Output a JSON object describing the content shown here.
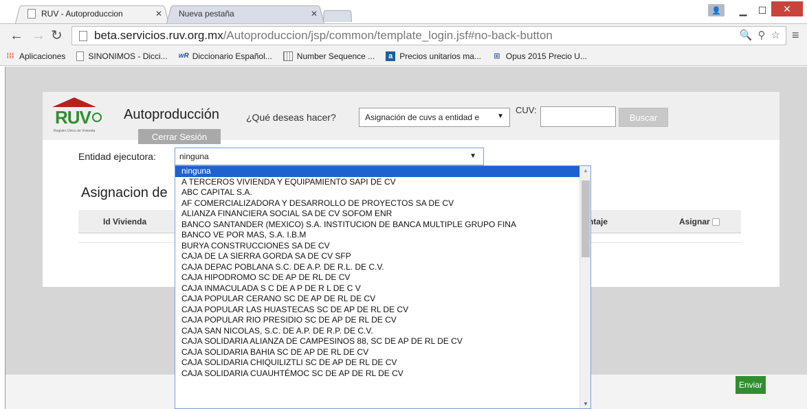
{
  "browser": {
    "tabs": [
      {
        "title": "RUV - Autoproduccion",
        "active": true
      },
      {
        "title": "Nueva pestaña",
        "active": false
      }
    ],
    "url_host": "beta.servicios.ruv.org.mx",
    "url_path": "/Autoproduccion/jsp/common/template_login.jsf#no-back-button",
    "bookmarks": [
      {
        "label": "Aplicaciones",
        "icon": "apps-icon"
      },
      {
        "label": "SINONIMOS - Dicci...",
        "icon": "page-icon"
      },
      {
        "label": "Diccionario Español...",
        "icon": "wordreference-icon"
      },
      {
        "label": "Number Sequence ...",
        "icon": "grid-icon"
      },
      {
        "label": "Precios unitarios ma...",
        "icon": "a-icon"
      },
      {
        "label": "Opus 2015 Precio U...",
        "icon": "network-icon"
      }
    ]
  },
  "header": {
    "logo_text": "RUV",
    "logo_tagline": "Registro Único de Vivienda",
    "app_title": "Autoproducción",
    "question": "¿Qué deseas hacer?",
    "action_value": "Asignación de cuvs a entidad e",
    "cuv_label": "CUV:",
    "search_label": "Buscar",
    "logout_label": "Cerrar Sesión"
  },
  "form": {
    "entity_label": "Entidad ejecutora:",
    "entity_value": "ninguna",
    "section_title": "Asignacion de",
    "columns": {
      "id": "Id Vivienda",
      "pct": "ntaje",
      "assign": "Asignar"
    },
    "send_label": "Enviar"
  },
  "dropdown_options": [
    "ninguna",
    "A TERCEROS VIVIENDA Y EQUIPAMIENTO SAPI DE CV",
    "ABC CAPITAL S.A.",
    "AF COMERCIALIZADORA Y DESARROLLO DE PROYECTOS SA DE CV",
    "ALIANZA FINANCIERA SOCIAL SA DE CV SOFOM ENR",
    "BANCO SANTANDER (MEXICO) S.A. INSTITUCION DE BANCA MULTIPLE GRUPO FINA",
    "BANCO VE POR MAS, S.A. I.B.M",
    "BURYA CONSTRUCCIONES SA DE CV",
    "CAJA DE LA SIERRA GORDA SA DE CV SFP",
    "CAJA DEPAC POBLANA S.C. DE A.P. DE R.L. DE C.V.",
    "CAJA HIPODROMO SC DE AP DE RL DE CV",
    "CAJA INMACULADA S C DE A P DE R L DE C V",
    "CAJA POPULAR CERANO SC DE AP DE RL DE CV",
    "CAJA POPULAR LAS HUASTECAS SC DE AP DE RL DE CV",
    "CAJA POPULAR RIO PRESIDIO SC DE AP DE RL DE CV",
    "CAJA SAN NICOLAS, S.C. DE A.P. DE R.P. DE C.V.",
    "CAJA SOLIDARIA ALIANZA DE CAMPESINOS 88, SC DE AP DE RL DE CV",
    "CAJA SOLIDARIA BAHIA SC DE AP DE RL DE CV",
    "CAJA SOLIDARIA CHIQUILIZTLI SC DE AP DE RL DE CV",
    "CAJA SOLIDARIA CUAUHTÉMOC SC DE AP DE RL DE CV"
  ],
  "colors": {
    "brand_green": "#2f8f2f",
    "brand_red": "#b5221e",
    "selection_blue": "#1e62d0"
  }
}
